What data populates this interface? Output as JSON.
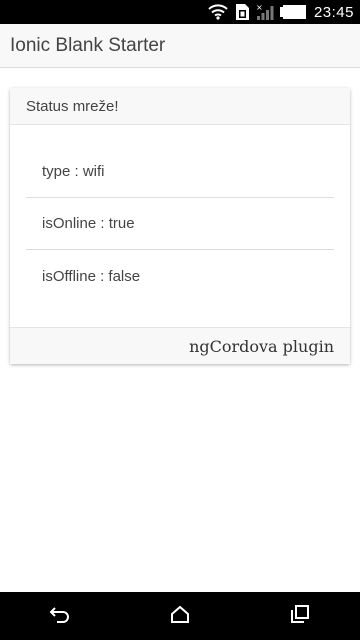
{
  "statusbar": {
    "time": "23:45",
    "icons": [
      "wifi-icon",
      "sim-icon",
      "signal-icon",
      "battery-icon"
    ]
  },
  "header": {
    "title": "Ionic Blank Starter"
  },
  "card": {
    "header": "Status mreže!",
    "items": [
      {
        "text": "type : wifi"
      },
      {
        "text": "isOnline : true"
      },
      {
        "text": "isOffline : false"
      }
    ],
    "footer": "ngCordova plugin"
  },
  "navbar": {
    "icons": [
      "back-icon",
      "home-icon",
      "recents-icon"
    ]
  }
}
